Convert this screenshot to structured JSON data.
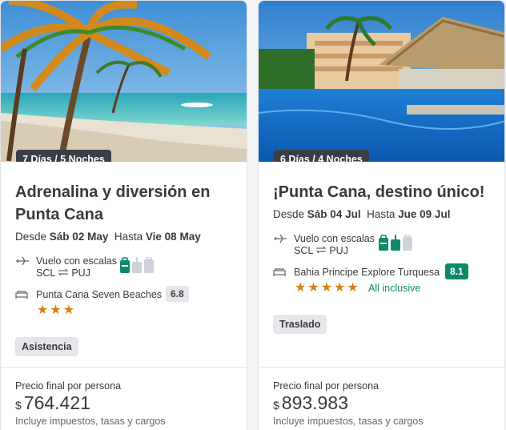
{
  "cards": [
    {
      "nights_badge": "7 Días / 5 Noches",
      "title": "Adrenalina y diversión en Punta Cana",
      "dates": {
        "from_label": "Desde",
        "from_date": "Sáb 02 May",
        "to_label": "Hasta",
        "to_date": "Vie 08 May"
      },
      "flight": {
        "label": "Vuelo con escalas",
        "origin": "SCL",
        "destination": "PUJ"
      },
      "hotel": {
        "name": "Punta Cana Seven Beaches",
        "score": "6.8",
        "stars": 3
      },
      "extra_tag": "Asistencia",
      "price": {
        "label": "Precio final por persona",
        "currency": "$",
        "amount": "764.421",
        "taxes": "Incluye impuestos, tasas y cargos"
      }
    },
    {
      "nights_badge": "6 Días / 4 Noches",
      "title": "¡Punta Cana, destino único!",
      "dates": {
        "from_label": "Desde",
        "from_date": "Sáb 04 Jul",
        "to_label": "Hasta",
        "to_date": "Jue 09 Jul"
      },
      "flight": {
        "label": "Vuelo con escalas",
        "origin": "SCL",
        "destination": "PUJ"
      },
      "hotel": {
        "name": "Bahia Principe Explore Turquesa",
        "score": "8.1",
        "stars": 5,
        "regime": "All inclusive"
      },
      "extra_tag": "Traslado",
      "price": {
        "label": "Precio final por persona",
        "currency": "$",
        "amount": "893.983",
        "taxes": "Incluye impuestos, tasas y cargos"
      }
    }
  ],
  "colors": {
    "accent_green": "#0e8a6b",
    "star_orange": "#d9800f",
    "badge_dark": "#3b3f45"
  }
}
